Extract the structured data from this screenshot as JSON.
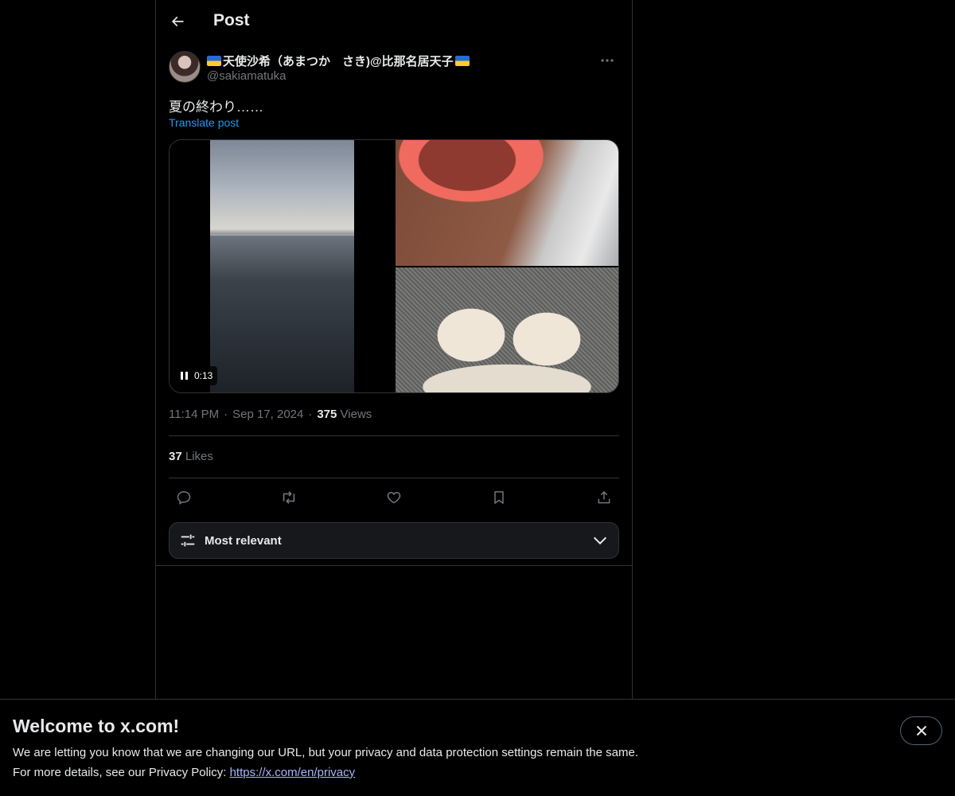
{
  "header": {
    "title": "Post"
  },
  "author": {
    "display_name": "天使沙希（あまつか　さき)@比那名居天子",
    "handle": "@sakiamatuka"
  },
  "post": {
    "text": "夏の終わり……",
    "translate_label": "Translate post",
    "video_time": "0:13"
  },
  "meta": {
    "time": "11:14 PM",
    "date": "Sep 17, 2024",
    "views_count": "375",
    "views_label": "Views"
  },
  "likes": {
    "count": "37",
    "label": "Likes"
  },
  "sort": {
    "label": "Most relevant"
  },
  "banner": {
    "title": "Welcome to x.com!",
    "line1": "We are letting you know that we are changing our URL, but your privacy and data protection settings remain the same.",
    "line2_prefix": "For more details, see our Privacy Policy: ",
    "link": "https://x.com/en/privacy"
  },
  "colors": {
    "background": "#000000",
    "text": "#e7e9ea",
    "muted": "#71767b",
    "accent": "#1d9bf0",
    "border": "#2f3336"
  },
  "icons": [
    "back-arrow-icon",
    "more-icon",
    "pause-icon",
    "reply-icon",
    "repost-icon",
    "like-icon",
    "bookmark-icon",
    "share-icon",
    "sliders-icon",
    "chevron-down-icon",
    "close-icon",
    "ukraine-flag-icon"
  ]
}
